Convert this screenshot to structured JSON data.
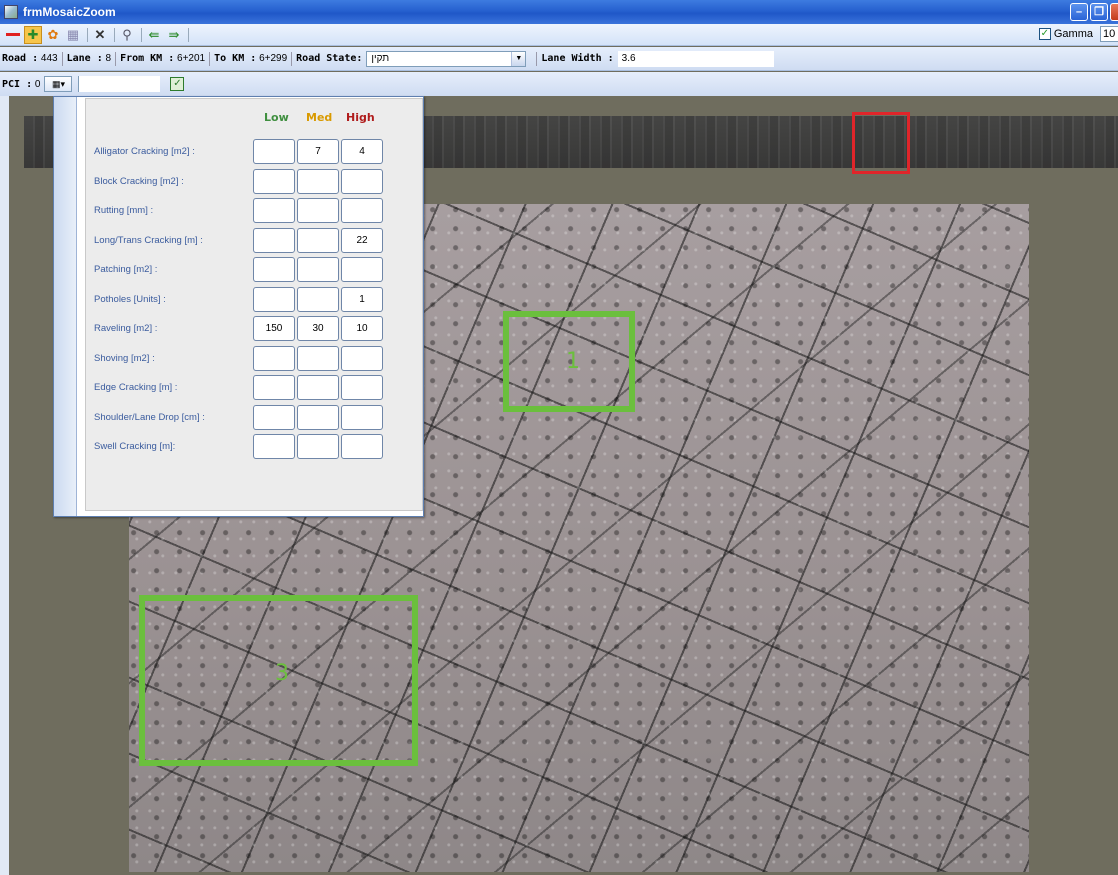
{
  "window": {
    "title": "frmMosaicZoom"
  },
  "toolbar": {
    "gamma_label": "Gamma",
    "gamma_checked": true,
    "gamma_value": "10"
  },
  "info": {
    "road_label": "Road :",
    "road_value": "443",
    "lane_label": "Lane :",
    "lane_value": "8",
    "from_km_label": "From KM :",
    "from_km_value": "6+201",
    "to_km_label": "To KM :",
    "to_km_value": "6+299",
    "road_state_label": "Road State:",
    "road_state_value": "תקין",
    "lane_width_label": "Lane Width :",
    "lane_width_value": "3.6"
  },
  "pci": {
    "label": "PCI :",
    "value": "0"
  },
  "distress": {
    "headers": {
      "low": "Low",
      "med": "Med",
      "high": "High"
    },
    "header_colors": {
      "low": "#3f8f3f",
      "med": "#d99a00",
      "high": "#b01c1c"
    },
    "rows": [
      {
        "label": "Alligator Cracking [m2] :",
        "low": "",
        "med": "7",
        "high": "4"
      },
      {
        "label": "Block Cracking [m2] :",
        "low": "",
        "med": "",
        "high": ""
      },
      {
        "label": "Rutting [mm] :",
        "low": "",
        "med": "",
        "high": ""
      },
      {
        "label": "Long/Trans Cracking [m] :",
        "low": "",
        "med": "",
        "high": "22"
      },
      {
        "label": "Patching [m2] :",
        "low": "",
        "med": "",
        "high": ""
      },
      {
        "label": "Potholes [Units] :",
        "low": "",
        "med": "",
        "high": "1"
      },
      {
        "label": "Raveling [m2] :",
        "low": "150",
        "med": "30",
        "high": "10"
      },
      {
        "label": "Shoving [m2] :",
        "low": "",
        "med": "",
        "high": ""
      },
      {
        "label": "Edge Cracking [m] :",
        "low": "",
        "med": "",
        "high": ""
      },
      {
        "label": "Shoulder/Lane Drop [cm] :",
        "low": "",
        "med": "",
        "high": ""
      },
      {
        "label": "Swell Cracking [m]:",
        "low": "",
        "med": "",
        "high": ""
      }
    ]
  },
  "markers": {
    "roi_1": "1",
    "roi_3": "3"
  },
  "colors": {
    "roi": "#6bbf3d",
    "strip_marker": "#e0252a"
  }
}
